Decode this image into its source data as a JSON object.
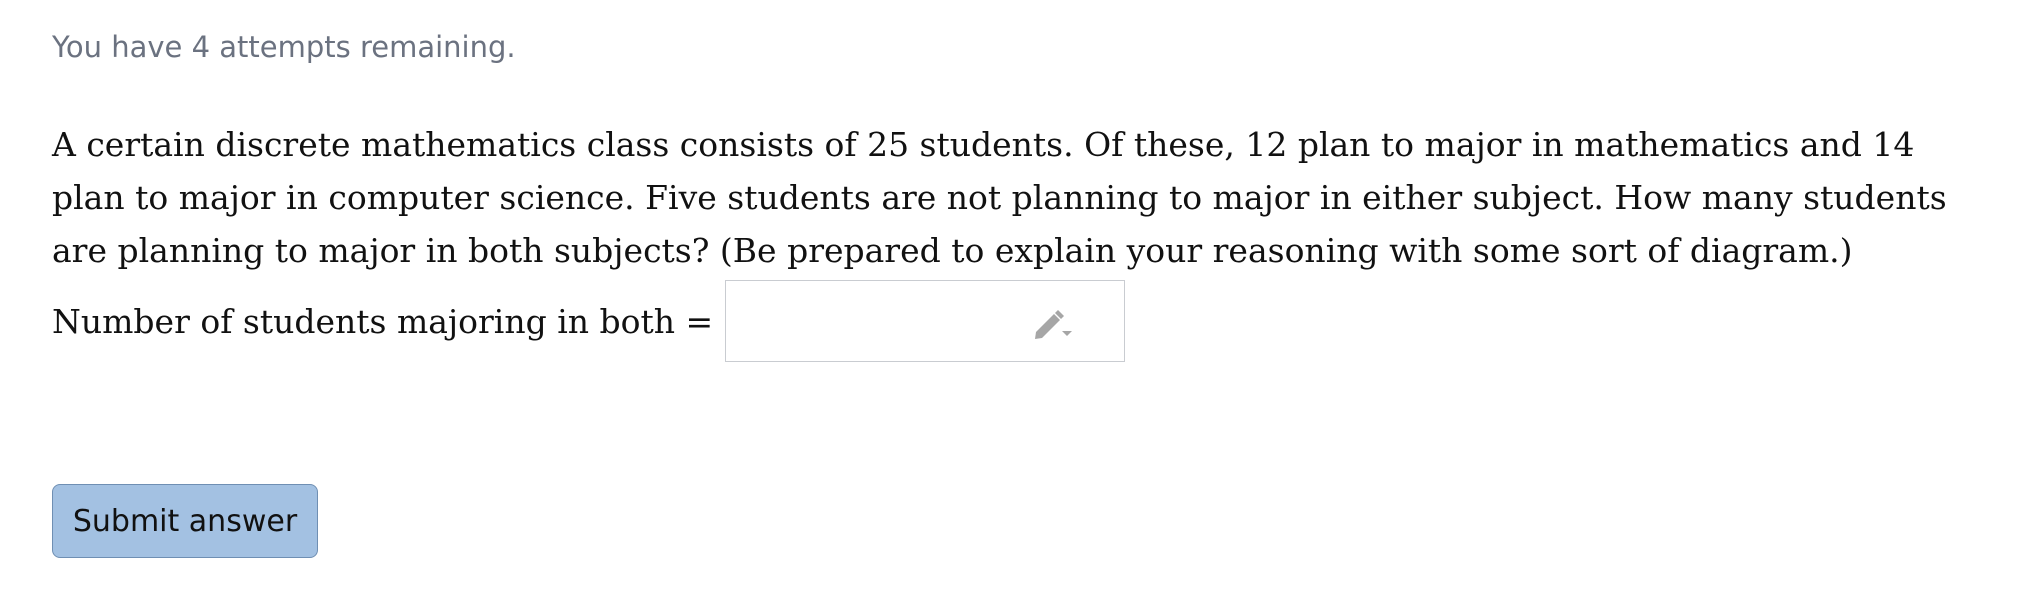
{
  "status": {
    "attempts_text": "You have 4 attempts remaining."
  },
  "question": {
    "text": "A certain discrete mathematics class consists of 25 students. Of these, 12 plan to major in mathematics and 14 plan to major in computer science. Five students are not planning to major in either subject. How many students are planning to major in both subjects? (Be prepared to explain your reasoning with some sort of diagram.)"
  },
  "answer": {
    "label": "Number of students majoring in both =",
    "value": "",
    "input_icon": "pencil-dropdown-icon"
  },
  "actions": {
    "submit_label": "Submit answer"
  },
  "colors": {
    "muted_text": "#6b7280",
    "button_bg": "#a3c1e2",
    "button_border": "#6f8fb3",
    "input_border": "#c9ccd1",
    "icon_gray": "#a6a6a6"
  }
}
